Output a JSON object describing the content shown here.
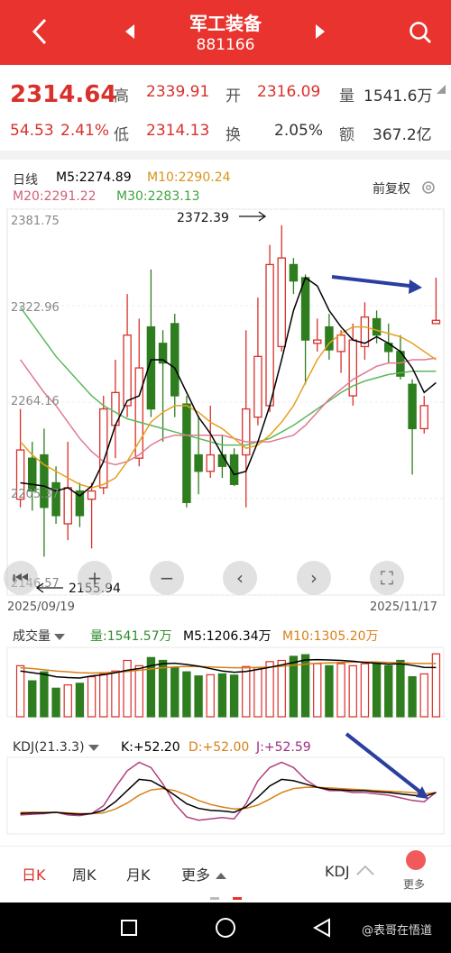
{
  "header": {
    "title": "军工装备",
    "code": "881166"
  },
  "quote": {
    "price": "2314.64",
    "change": "54.53",
    "change_pct": "2.41%",
    "high_label": "高",
    "high": "2339.91",
    "open_label": "开",
    "open": "2316.09",
    "vol_label": "量",
    "vol": "1541.6万",
    "low_label": "低",
    "low": "2314.13",
    "turnover_label": "换",
    "turnover": "2.05%",
    "amount_label": "额",
    "amount": "367.2亿"
  },
  "kline": {
    "period": "日线",
    "m5": "M5:2274.89",
    "m10": "M10:2290.24",
    "m20": "M20:2291.22",
    "m30": "M30:2283.13",
    "adjust": "前复权",
    "axis": {
      "top": "2381.75",
      "mid1": "2322.96",
      "mid2": "2264.16",
      "low": "2205.37",
      "bottom": "2146.57"
    },
    "max_note": "2372.39",
    "min_note": "2155.94",
    "date_start": "2025/09/19",
    "date_end": "2025/11/17"
  },
  "volume": {
    "label": "成交量",
    "vol": "量:1541.57万",
    "m5": "M5:1206.34万",
    "m10": "M10:1305.20万"
  },
  "kdj": {
    "label": "KDJ(21.3.3)",
    "k": "K:+52.20",
    "d": "D:+52.00",
    "j": "J:+52.59"
  },
  "tabs": {
    "day": "日K",
    "week": "周K",
    "month": "月K",
    "more": "更多",
    "kdj": "KDJ",
    "more2": "更多"
  },
  "watermark": "@表哥在悟道",
  "colors": {
    "up": "#d9302b",
    "down": "#2e7d1f",
    "m5": "#000000",
    "m10": "#e6a020",
    "m20": "#e07a90",
    "m30": "#5cb85c",
    "arrow": "#2a3fa0"
  },
  "chart_data": {
    "type": "candlestick",
    "ylim": [
      2146.57,
      2381.75
    ],
    "ticks": [
      2381.75,
      2322.96,
      2264.16,
      2205.37,
      2146.57
    ],
    "candles": [
      {
        "o": 2205,
        "c": 2235,
        "h": 2260,
        "l": 2200
      },
      {
        "o": 2230,
        "c": 2210,
        "h": 2240,
        "l": 2198
      },
      {
        "o": 2232,
        "c": 2200,
        "h": 2248,
        "l": 2170
      },
      {
        "o": 2215,
        "c": 2195,
        "h": 2225,
        "l": 2190
      },
      {
        "o": 2190,
        "c": 2212,
        "h": 2240,
        "l": 2180
      },
      {
        "o": 2210,
        "c": 2195,
        "h": 2215,
        "l": 2188
      },
      {
        "o": 2205,
        "c": 2210,
        "h": 2215,
        "l": 2175
      },
      {
        "o": 2212,
        "c": 2260,
        "h": 2268,
        "l": 2208
      },
      {
        "o": 2250,
        "c": 2270,
        "h": 2290,
        "l": 2230
      },
      {
        "o": 2262,
        "c": 2305,
        "h": 2330,
        "l": 2255
      },
      {
        "o": 2230,
        "c": 2285,
        "h": 2315,
        "l": 2225
      },
      {
        "o": 2310,
        "c": 2260,
        "h": 2345,
        "l": 2255
      },
      {
        "o": 2300,
        "c": 2288,
        "h": 2308,
        "l": 2240
      },
      {
        "o": 2312,
        "c": 2268,
        "h": 2318,
        "l": 2255
      },
      {
        "o": 2263,
        "c": 2203,
        "h": 2268,
        "l": 2200
      },
      {
        "o": 2232,
        "c": 2222,
        "h": 2256,
        "l": 2208
      },
      {
        "o": 2222,
        "c": 2232,
        "h": 2262,
        "l": 2218
      },
      {
        "o": 2232,
        "c": 2225,
        "h": 2244,
        "l": 2218
      },
      {
        "o": 2232,
        "c": 2214,
        "h": 2236,
        "l": 2213
      },
      {
        "o": 2232,
        "c": 2260,
        "h": 2308,
        "l": 2200
      },
      {
        "o": 2255,
        "c": 2292,
        "h": 2328,
        "l": 2250
      },
      {
        "o": 2262,
        "c": 2348,
        "h": 2360,
        "l": 2258
      },
      {
        "o": 2298,
        "c": 2352,
        "h": 2372,
        "l": 2295
      },
      {
        "o": 2348,
        "c": 2338,
        "h": 2352,
        "l": 2330
      },
      {
        "o": 2340,
        "c": 2302,
        "h": 2342,
        "l": 2275
      },
      {
        "o": 2300,
        "c": 2302,
        "h": 2315,
        "l": 2295
      },
      {
        "o": 2310,
        "c": 2296,
        "h": 2318,
        "l": 2290
      },
      {
        "o": 2295,
        "c": 2305,
        "h": 2308,
        "l": 2282
      },
      {
        "o": 2268,
        "c": 2302,
        "h": 2312,
        "l": 2262
      },
      {
        "o": 2298,
        "c": 2316,
        "h": 2325,
        "l": 2290
      },
      {
        "o": 2315,
        "c": 2305,
        "h": 2320,
        "l": 2300
      },
      {
        "o": 2300,
        "c": 2295,
        "h": 2312,
        "l": 2288
      },
      {
        "o": 2295,
        "c": 2280,
        "h": 2305,
        "l": 2278
      },
      {
        "o": 2275,
        "c": 2248,
        "h": 2278,
        "l": 2220
      },
      {
        "o": 2248,
        "c": 2262,
        "h": 2268,
        "l": 2245
      },
      {
        "o": 2312,
        "c": 2314,
        "h": 2340,
        "l": 2314
      }
    ],
    "ma_m5": [
      2215,
      2214,
      2213,
      2210,
      2212,
      2207,
      2213,
      2228,
      2250,
      2265,
      2268,
      2290,
      2290,
      2285,
      2270,
      2255,
      2245,
      2232,
      2220,
      2222,
      2240,
      2262,
      2290,
      2320,
      2340,
      2335,
      2320,
      2310,
      2302,
      2300,
      2304,
      2300,
      2295,
      2285,
      2270,
      2276
    ],
    "ma_m10": [
      2240,
      2232,
      2226,
      2222,
      2218,
      2214,
      2212,
      2214,
      2218,
      2228,
      2240,
      2252,
      2258,
      2262,
      2262,
      2258,
      2252,
      2248,
      2242,
      2236,
      2238,
      2244,
      2252,
      2262,
      2276,
      2290,
      2300,
      2306,
      2310,
      2310,
      2308,
      2306,
      2304,
      2300,
      2295,
      2290
    ],
    "ma_m20": [
      2290,
      2280,
      2270,
      2262,
      2252,
      2242,
      2234,
      2228,
      2226,
      2228,
      2232,
      2238,
      2242,
      2244,
      2244,
      2244,
      2244,
      2244,
      2242,
      2240,
      2240,
      2240,
      2242,
      2244,
      2250,
      2258,
      2266,
      2272,
      2278,
      2282,
      2286,
      2288,
      2288,
      2290,
      2290,
      2291
    ],
    "ma_m30": [
      2322,
      2312,
      2302,
      2292,
      2284,
      2276,
      2268,
      2262,
      2258,
      2254,
      2252,
      2250,
      2248,
      2246,
      2244,
      2242,
      2240,
      2238,
      2238,
      2238,
      2240,
      2242,
      2246,
      2250,
      2255,
      2260,
      2265,
      2270,
      2274,
      2277,
      2279,
      2281,
      2282,
      2283,
      2283,
      2283
    ],
    "volume": [
      1250,
      880,
      1100,
      700,
      780,
      820,
      980,
      1050,
      1120,
      1380,
      1250,
      1450,
      1380,
      1200,
      1100,
      1000,
      1030,
      1050,
      1020,
      1230,
      1200,
      1350,
      1380,
      1480,
      1520,
      1300,
      1250,
      1300,
      1250,
      1300,
      1320,
      1250,
      1380,
      980,
      1050,
      1541.57
    ],
    "vol_m5": [
      1120,
      1080,
      1040,
      980,
      960,
      950,
      1000,
      1030,
      1080,
      1140,
      1180,
      1250,
      1300,
      1310,
      1280,
      1240,
      1180,
      1120,
      1090,
      1110,
      1160,
      1210,
      1270,
      1330,
      1390,
      1400,
      1390,
      1380,
      1360,
      1330,
      1310,
      1290,
      1300,
      1260,
      1210,
      1206
    ],
    "vol_m10": [
      1200,
      1180,
      1150,
      1120,
      1100,
      1080,
      1070,
      1080,
      1090,
      1110,
      1140,
      1170,
      1200,
      1220,
      1230,
      1230,
      1220,
      1210,
      1200,
      1200,
      1210,
      1220,
      1240,
      1260,
      1290,
      1310,
      1320,
      1330,
      1340,
      1340,
      1340,
      1330,
      1320,
      1310,
      1305,
      1305
    ],
    "kdj_k": [
      20,
      21,
      21,
      22,
      20,
      19,
      20,
      25,
      38,
      55,
      72,
      70,
      60,
      48,
      35,
      28,
      25,
      24,
      22,
      30,
      45,
      62,
      72,
      70,
      65,
      60,
      57,
      56,
      55,
      55,
      53,
      52,
      50,
      48,
      46,
      52
    ],
    "kdj_d": [
      22,
      22,
      22,
      22,
      21,
      20,
      20,
      21,
      27,
      36,
      48,
      56,
      58,
      55,
      48,
      40,
      34,
      30,
      27,
      28,
      33,
      42,
      52,
      58,
      60,
      60,
      59,
      58,
      57,
      56,
      55,
      54,
      53,
      52,
      50,
      52
    ],
    "kdj_j": [
      18,
      19,
      20,
      22,
      18,
      17,
      20,
      32,
      60,
      85,
      98,
      90,
      65,
      35,
      15,
      10,
      12,
      14,
      12,
      35,
      70,
      90,
      98,
      90,
      72,
      60,
      55,
      55,
      52,
      52,
      50,
      48,
      44,
      40,
      38,
      52.59
    ]
  }
}
